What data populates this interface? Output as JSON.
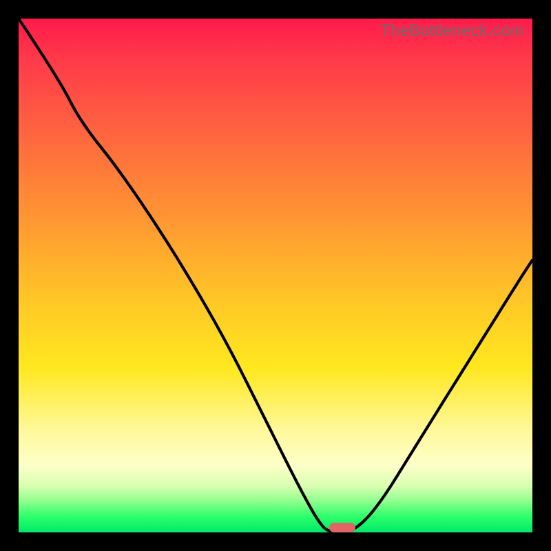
{
  "watermark": "TheBottleneck.com",
  "colors": {
    "frame": "#000000",
    "curve": "#000000",
    "marker": "#e06666",
    "gradient_stops": [
      "#ff1a4b",
      "#ff3a4a",
      "#ff6a3e",
      "#ff9a32",
      "#ffc726",
      "#ffe81f",
      "#fff89a",
      "#fdffc8",
      "#d8ffb0",
      "#8dff8d",
      "#2bff6a",
      "#00e86a"
    ]
  },
  "chart_data": {
    "type": "line",
    "title": "",
    "xlabel": "",
    "ylabel": "",
    "xlim": [
      0,
      100
    ],
    "ylim": [
      0,
      100
    ],
    "grid": false,
    "curve": {
      "x": [
        0,
        8,
        12,
        20,
        30,
        40,
        48,
        55,
        59,
        61,
        65,
        70,
        78,
        88,
        98,
        100
      ],
      "y_pct": [
        100,
        88,
        80,
        70,
        55,
        38,
        22,
        8,
        1,
        0,
        0,
        5,
        18,
        34,
        50,
        53
      ]
    },
    "marker": {
      "x": 63,
      "y_pct": 0,
      "width_pct": 5
    },
    "note": "y_pct is percent of plot height from bottom (0 = bottom baseline, 100 = top)."
  }
}
